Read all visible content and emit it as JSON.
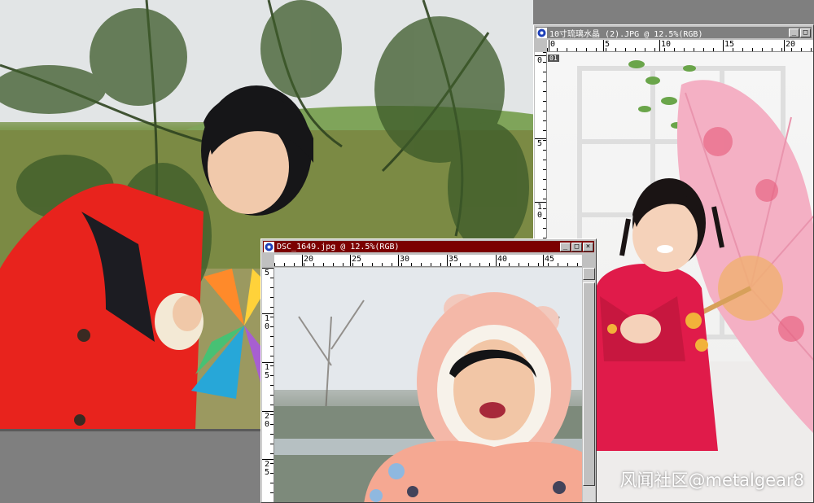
{
  "windows": {
    "right": {
      "title": "10寸琉璃水晶 (2).JPG @ 12.5%(RGB)",
      "ruler_h": [
        "0",
        "5",
        "10",
        "15",
        "20"
      ],
      "ruler_v": [
        "0",
        "5",
        "1\n0"
      ],
      "guide_badge": "01",
      "title_color": "#808080"
    },
    "front": {
      "title": "DSC_1649.jpg @ 12.5%(RGB)",
      "ruler_h": [
        "20",
        "25",
        "30",
        "35",
        "40",
        "45"
      ],
      "ruler_v": [
        "5",
        "1\n0",
        "1\n5",
        "2\n0",
        "2\n5"
      ],
      "title_color": "#7b0000"
    }
  },
  "window_buttons": {
    "minimize": "_",
    "maximize": "□",
    "close": "×"
  },
  "watermark": "风闻社区@metalgear8"
}
